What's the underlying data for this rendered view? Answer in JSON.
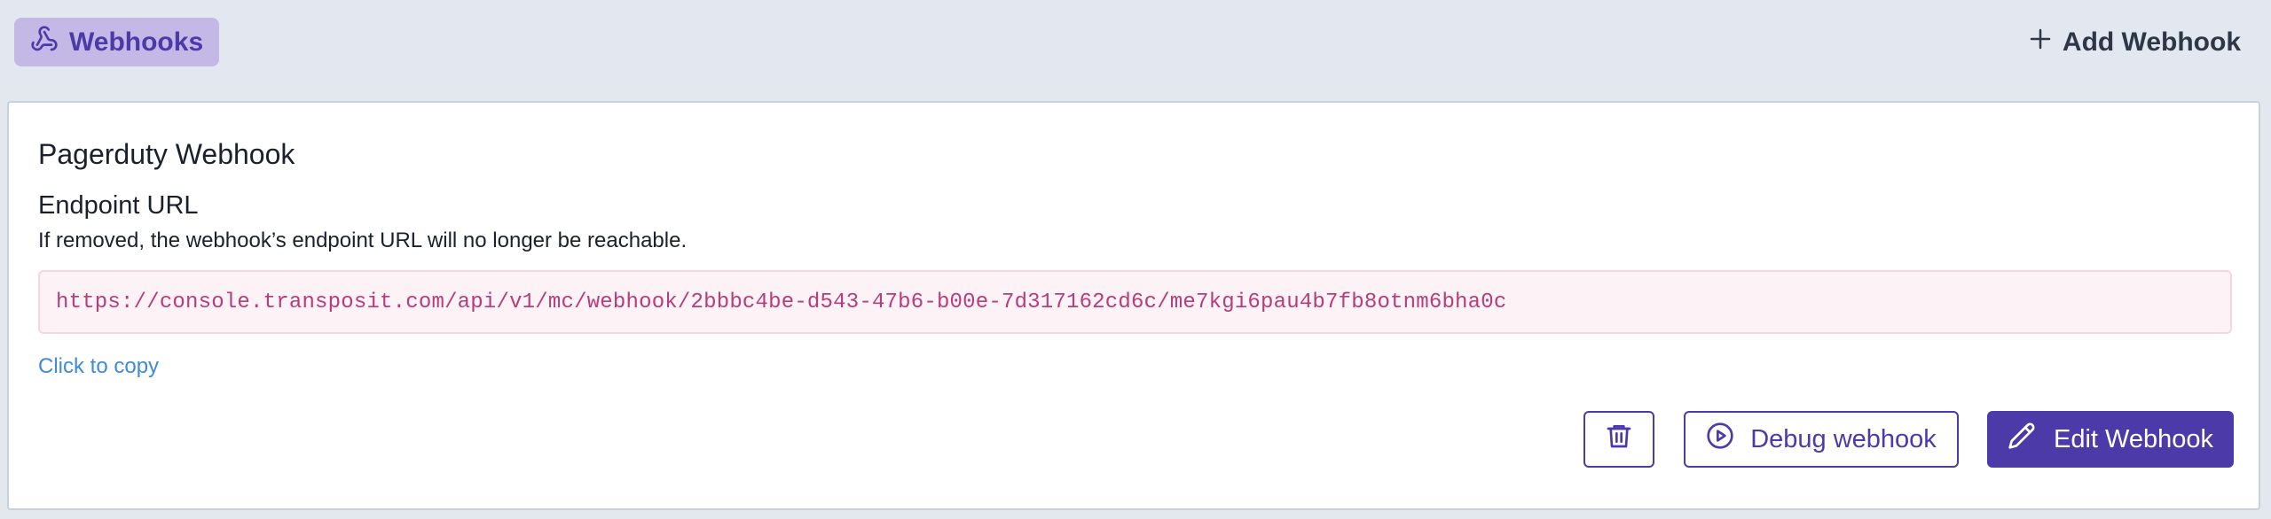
{
  "header": {
    "section_label": "Webhooks",
    "add_button_label": "Add Webhook"
  },
  "webhook": {
    "name": "Pagerduty Webhook",
    "endpoint_title": "Endpoint URL",
    "endpoint_description": "If removed, the webhook’s endpoint URL will no longer be reachable.",
    "endpoint_url": "https://console.transposit.com/api/v1/mc/webhook/2bbbc4be-d543-47b6-b00e-7d317162cd6c/me7kgi6pau4b7fb8otnm6bha0c",
    "copy_label": "Click to copy"
  },
  "actions": {
    "debug_label": "Debug webhook",
    "edit_label": "Edit Webhook"
  },
  "colors": {
    "accent": "#4c3aa8",
    "pill_bg": "#c3b8e6",
    "url_text": "#b83c7a",
    "url_bg": "#fdf2f6",
    "link": "#3f8bd6",
    "page_bg": "#e3e8ef"
  },
  "icons": {
    "webhooks": "webhook-icon",
    "add": "plus-icon",
    "delete": "trash-icon",
    "debug": "play-circle-icon",
    "edit": "pencil-icon"
  }
}
